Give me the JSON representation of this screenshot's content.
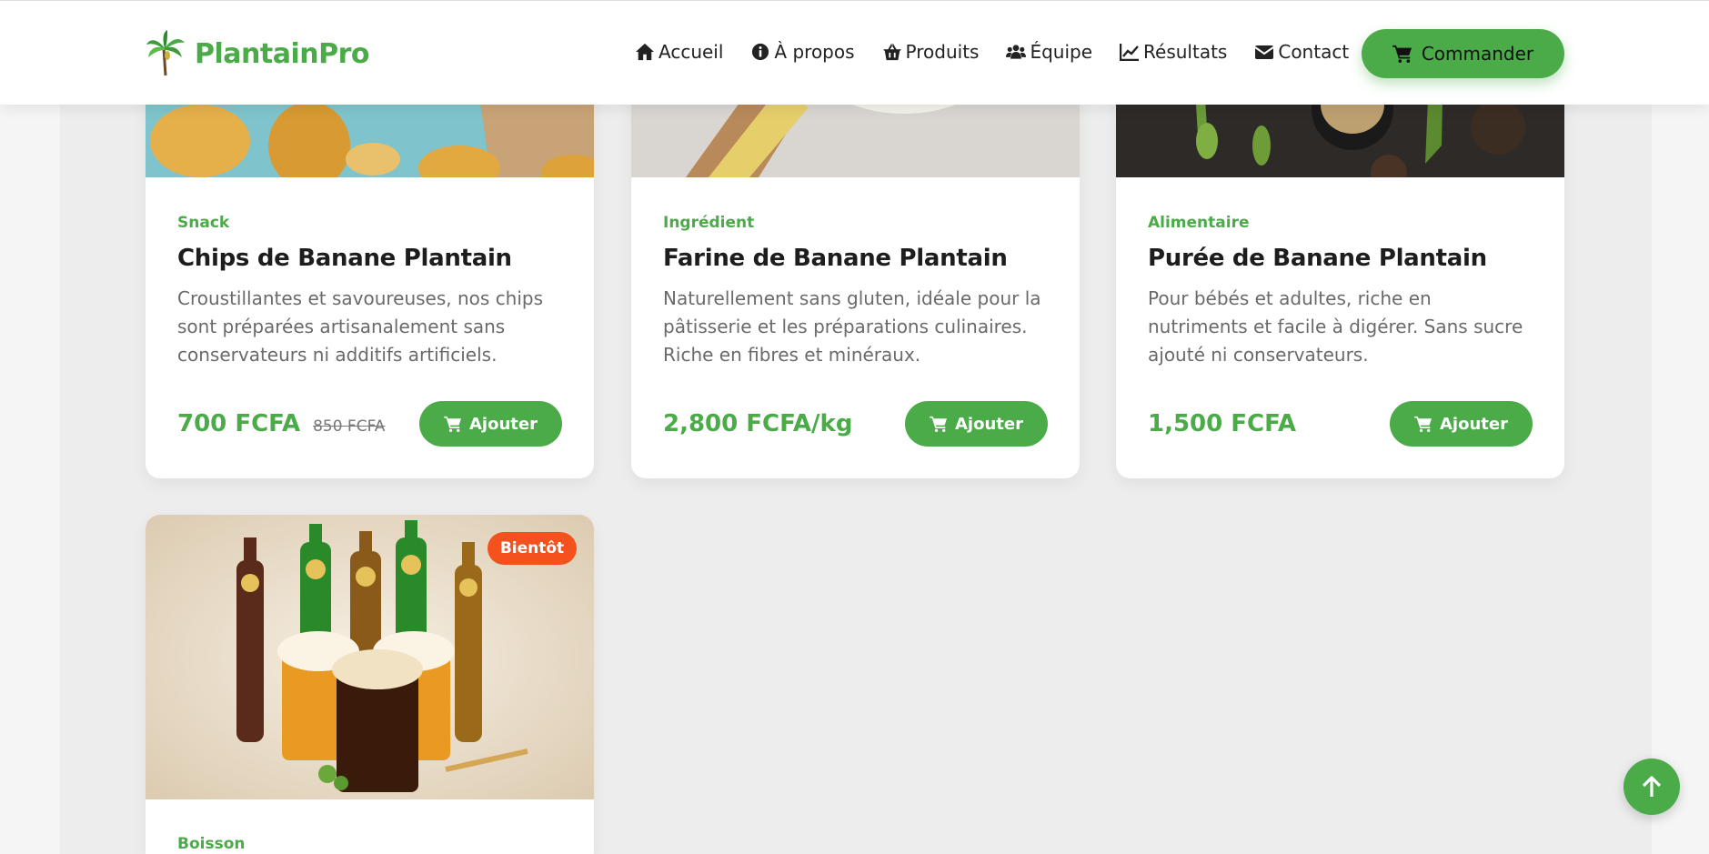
{
  "brand": {
    "name": "PlantainPro",
    "logo_icon": "plantain-tree-icon",
    "color": "#4aab48"
  },
  "nav": [
    {
      "label": "Accueil",
      "icon": "home-icon"
    },
    {
      "label": "À propos",
      "icon": "info-circle-icon"
    },
    {
      "label": "Produits",
      "icon": "basket-icon"
    },
    {
      "label": "Équipe",
      "icon": "users-icon"
    },
    {
      "label": "Résultats",
      "icon": "line-chart-icon"
    },
    {
      "label": "Contact",
      "icon": "envelope-icon"
    }
  ],
  "cta": {
    "label": "Commander",
    "icon": "cart-icon"
  },
  "products": [
    {
      "category": "Snack",
      "title": "Chips de Banane Plantain",
      "description": "Croustillantes et savoureuses, nos chips sont préparées artisanalement sans conservateurs ni additifs artificiels.",
      "price": "700 FCFA",
      "old_price": "850 FCFA",
      "button": "Ajouter"
    },
    {
      "category": "Ingrédient",
      "title": "Farine de Banane Plantain",
      "description": "Naturellement sans gluten, idéale pour la pâtisserie et les préparations culinaires. Riche en fibres et minéraux.",
      "price": "2,800 FCFA/kg",
      "button": "Ajouter"
    },
    {
      "category": "Alimentaire",
      "title": "Purée de Banane Plantain",
      "description": "Pour bébés et adultes, riche en nutriments et facile à digérer. Sans sucre ajouté ni conservateurs.",
      "price": "1,500 FCFA",
      "button": "Ajouter"
    },
    {
      "category": "Boisson",
      "badge": "Bientôt"
    }
  ],
  "accent_colors": {
    "primary": "#4aab48",
    "badge": "#f4511e"
  }
}
